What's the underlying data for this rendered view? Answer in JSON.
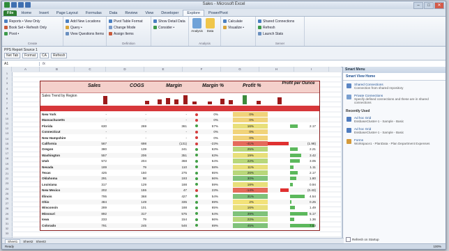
{
  "window": {
    "title": "Sales - Microsoft Excel",
    "controls": [
      "–",
      "□",
      "✕"
    ]
  },
  "ribbon_tabs": [
    "File",
    "Home",
    "Insert",
    "Page Layout",
    "Formulas",
    "Data",
    "Review",
    "View",
    "Developer",
    "Explore",
    "PowerPivot"
  ],
  "ribbon": {
    "groups": [
      {
        "label": "Create",
        "rows": [
          "Reports • View Only",
          "Book Set • Refresh Only",
          "Pivot •"
        ]
      },
      {
        "label": "",
        "rows": [
          "Add New Locations",
          "Query •",
          "View Questions Items"
        ]
      },
      {
        "label": "Definition",
        "rows": [
          "Pivot Table Format",
          "Change Mode",
          "Assign Items"
        ]
      },
      {
        "label": "",
        "rows": [
          "Show Detail Data",
          "Consider •",
          ""
        ]
      },
      {
        "label": "Analysis",
        "big": [
          "Analysis",
          "Data"
        ]
      },
      {
        "label": "",
        "rows": [
          "Calculate",
          "Visualize •",
          ""
        ]
      },
      {
        "label": "Server",
        "rows": [
          "Shared Connections",
          "Refresh",
          "Launch Stats"
        ]
      }
    ]
  },
  "pivot_bar": {
    "label": "PPS Report Source 1",
    "fields": [
      "Net Tab",
      "Format",
      "CA",
      "Refresh"
    ]
  },
  "formula_bar": {
    "namebox": "A1",
    "fx": "fx"
  },
  "columns": [
    "A",
    "B",
    "C",
    "D",
    "E",
    "F",
    "G",
    "H",
    "I",
    "J",
    "K"
  ],
  "table": {
    "headers": [
      "Sales",
      "COGS",
      "Margin",
      "Margin %",
      "Profit %",
      "Profit per Ounce"
    ],
    "spark_label": "Sales Trend by Region",
    "spark_values": [
      0.8,
      0.35,
      0.45,
      0.6,
      0.5,
      0.85,
      0.3,
      0.25,
      0.55,
      0.4,
      0.9,
      0.35,
      0.7
    ],
    "rows": [
      {
        "state": "New York",
        "sales": "-",
        "cogs": "-",
        "margin": "-",
        "ind": "red",
        "mpct": "0%",
        "ppct": "0%",
        "pr": "",
        "bar": 0,
        "neg": 0
      },
      {
        "state": "Massachusetts",
        "sales": "-",
        "cogs": "-",
        "margin": "-",
        "ind": "red",
        "mpct": "0%",
        "ppct": "0%",
        "pr": "",
        "bar": 0,
        "neg": 0
      },
      {
        "state": "Florida",
        "sales": "630",
        "cogs": "269",
        "margin": "361",
        "ind": "green",
        "mpct": "57%",
        "ppct": "16%",
        "pr": "2.17",
        "bar": 0.3,
        "neg": 0
      },
      {
        "state": "Connecticut",
        "sales": "-",
        "cogs": "-",
        "margin": "-",
        "ind": "red",
        "mpct": "0%",
        "ppct": "0%",
        "pr": "",
        "bar": 0,
        "neg": 0
      },
      {
        "state": "New Hampshire",
        "sales": "-",
        "cogs": "-",
        "margin": "-",
        "ind": "red",
        "mpct": "0%",
        "ppct": "0%",
        "pr": "",
        "bar": 0,
        "neg": 0
      },
      {
        "state": "California",
        "sales": "567",
        "cogs": "698",
        "margin": "(131)",
        "ind": "red",
        "mpct": "-23%",
        "ppct": "-41%",
        "pr": "(1.98)",
        "bar": 0,
        "neg": 1
      },
      {
        "state": "Oregon",
        "sales": "380",
        "cogs": "139",
        "margin": "241",
        "ind": "green",
        "mpct": "63%",
        "ppct": "25%",
        "pr": "2.21",
        "bar": 0.3,
        "neg": 0
      },
      {
        "state": "Washington",
        "sales": "557",
        "cogs": "206",
        "margin": "351",
        "ind": "green",
        "mpct": "63%",
        "ppct": "19%",
        "pr": "3.42",
        "bar": 0.45,
        "neg": 0
      },
      {
        "state": "Utah",
        "sales": "572",
        "cogs": "204",
        "margin": "368",
        "ind": "green",
        "mpct": "64%",
        "ppct": "22%",
        "pr": "3.05",
        "bar": 0.4,
        "neg": 0
      },
      {
        "state": "Nevada",
        "sales": "189",
        "cogs": "79",
        "margin": "110",
        "ind": "green",
        "mpct": "58%",
        "ppct": "11%",
        "pr": "1.11",
        "bar": 0.15,
        "neg": 0
      },
      {
        "state": "Texas",
        "sales": "425",
        "cogs": "150",
        "margin": "275",
        "ind": "green",
        "mpct": "65%",
        "ppct": "26%",
        "pr": "2.17",
        "bar": 0.3,
        "neg": 0
      },
      {
        "state": "Oklahoma",
        "sales": "291",
        "cogs": "98",
        "margin": "193",
        "ind": "green",
        "mpct": "66%",
        "ppct": "30%",
        "pr": "1.80",
        "bar": 0.25,
        "neg": 0
      },
      {
        "state": "Louisiana",
        "sales": "317",
        "cogs": "129",
        "margin": "188",
        "ind": "green",
        "mpct": "59%",
        "ppct": "18%",
        "pr": "0.94",
        "bar": 0.12,
        "neg": 0
      },
      {
        "state": "New Mexico",
        "sales": "202",
        "cogs": "155",
        "margin": "47",
        "ind": "red",
        "mpct": "23%",
        "ppct": "-14%",
        "pr": "(0.43)",
        "bar": 0,
        "neg": 0.4
      },
      {
        "state": "Illinois",
        "sales": "795",
        "cogs": "368",
        "margin": "427",
        "ind": "green",
        "mpct": "54%",
        "ppct": "31%",
        "pr": "4.54",
        "bar": 0.6,
        "neg": 0
      },
      {
        "state": "Ohio",
        "sales": "484",
        "cogs": "149",
        "margin": "335",
        "ind": "green",
        "mpct": "69%",
        "ppct": "2%",
        "pr": "0.25",
        "bar": 0.05,
        "neg": 0
      },
      {
        "state": "Wisconsin",
        "sales": "289",
        "cogs": "101",
        "margin": "188",
        "ind": "green",
        "mpct": "65%",
        "ppct": "16%",
        "pr": "1.49",
        "bar": 0.2,
        "neg": 0
      },
      {
        "state": "Missouri",
        "sales": "892",
        "cogs": "317",
        "margin": "575",
        "ind": "green",
        "mpct": "64%",
        "ppct": "39%",
        "pr": "5.17",
        "bar": 0.7,
        "neg": 0
      },
      {
        "state": "Iowa",
        "sales": "233",
        "cogs": "79",
        "margin": "154",
        "ind": "green",
        "mpct": "66%",
        "ppct": "22%",
        "pr": "1.36",
        "bar": 0.18,
        "neg": 0
      },
      {
        "state": "Colorado",
        "sales": "791",
        "cogs": "245",
        "margin": "546",
        "ind": "green",
        "mpct": "69%",
        "ppct": "45%",
        "pr": "7.53",
        "bar": 1,
        "neg": 0
      }
    ]
  },
  "sheet_tabs": [
    "Sheet1",
    "Sheet2",
    "Sheet3"
  ],
  "status": {
    "left": "Ready",
    "zoom": "100%"
  },
  "pane": {
    "title": "Smart Menu",
    "subtitle": "Smart View Home",
    "items": [
      {
        "name": "Shared Connections",
        "desc": "Connection from shared repository"
      },
      {
        "name": "Private Connections",
        "desc": "Specify defined connections and these are in shared connections"
      }
    ],
    "recent_title": "Recently Used",
    "recent": [
      {
        "name": "Ad hoc Grid",
        "desc": "EssbaseCluster-1 - Sample - Basic"
      },
      {
        "name": "Ad hoc Grid",
        "desc": "EssbaseCluster-1 - Sample - Basic"
      },
      {
        "name": "Forms",
        "desc": "Workspace1 - PlanData - Plan Department Expenses"
      }
    ],
    "footer": "Refresh on Startup"
  }
}
